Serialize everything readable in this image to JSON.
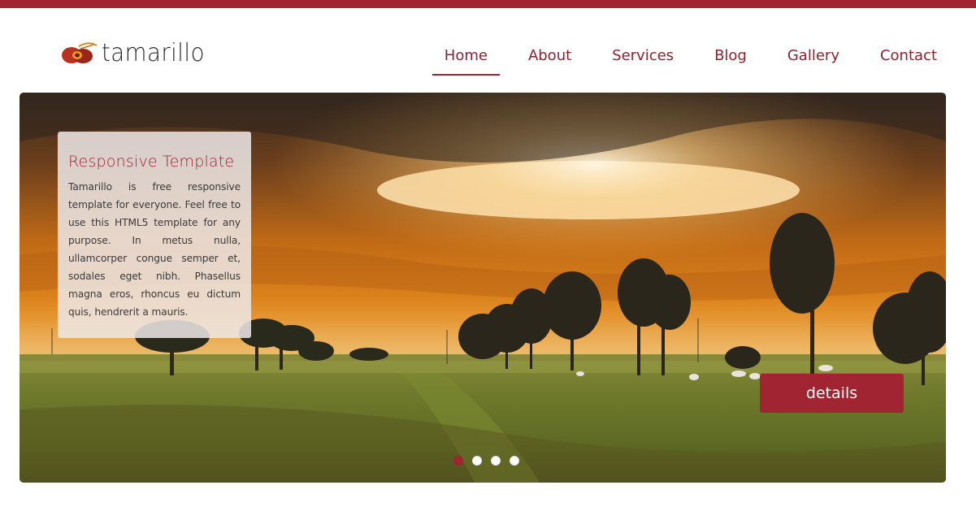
{
  "brand": {
    "name": "tamarillo",
    "accent_color": "#a02431"
  },
  "nav": {
    "items": [
      {
        "label": "Home",
        "active": true
      },
      {
        "label": "About",
        "active": false
      },
      {
        "label": "Services",
        "active": false
      },
      {
        "label": "Blog",
        "active": false
      },
      {
        "label": "Gallery",
        "active": false
      },
      {
        "label": "Contact",
        "active": false
      }
    ]
  },
  "hero": {
    "caption_title": "Responsive Template",
    "caption_text": "Tamarillo is free responsive template for everyone. Feel free to use this HTML5 template for any purpose. In metus nulla, ullamcorper congue semper et, sodales eget nibh. Phasellus magna eros, rhoncus eu dictum quis, hendrerit a mauris.",
    "details_label": "details",
    "slide_count": 4,
    "active_slide": 1
  }
}
